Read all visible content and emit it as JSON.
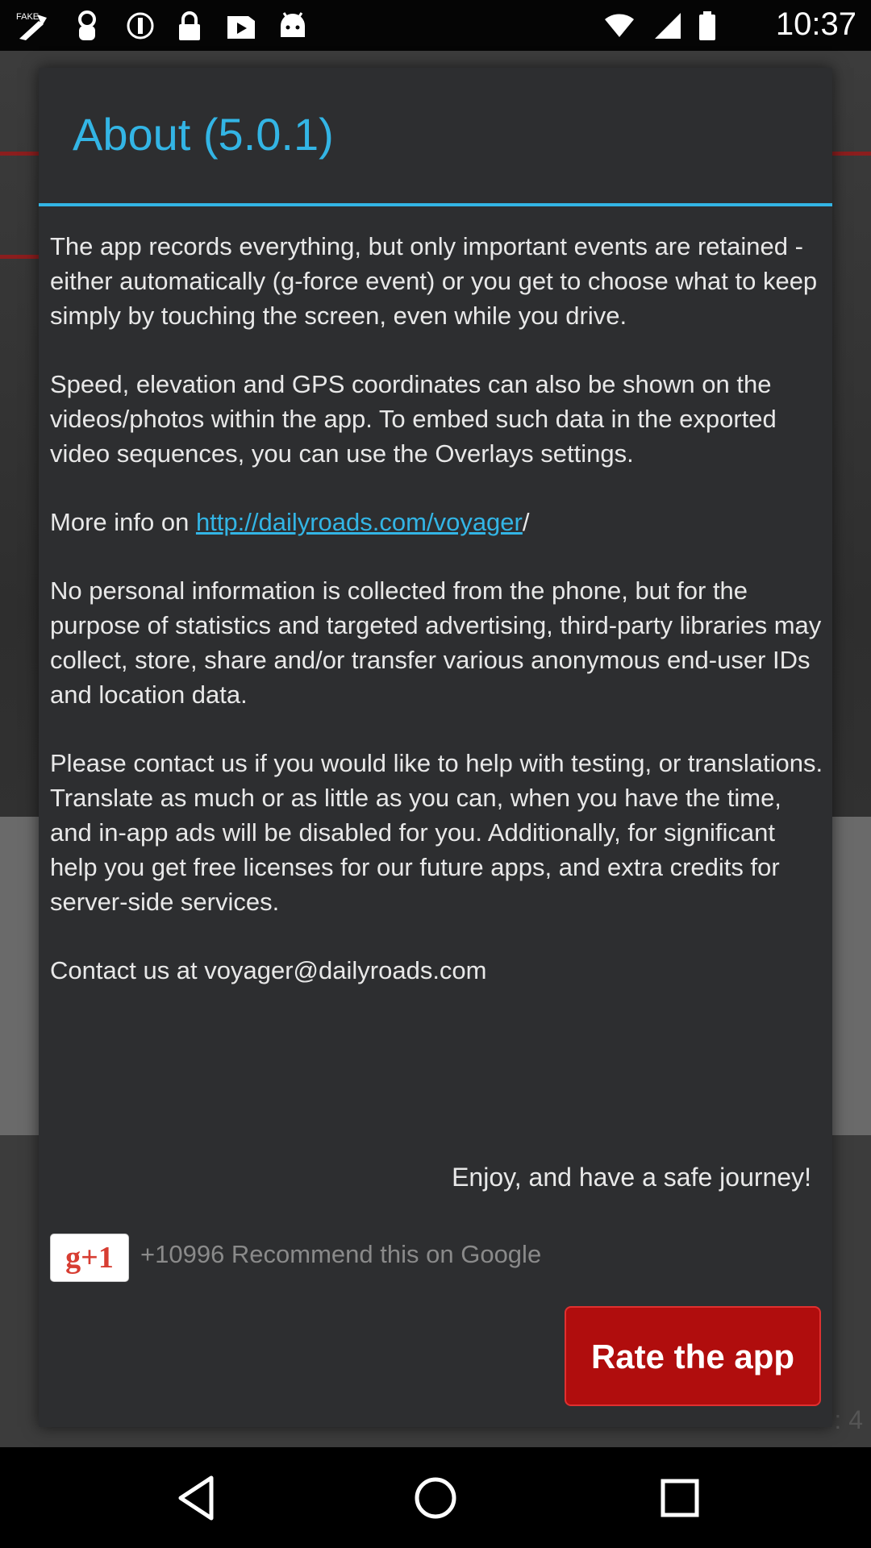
{
  "status_bar": {
    "time": "10:37",
    "icons": [
      "fake-gps-icon",
      "tv-remote-icon",
      "location-icon",
      "lock-icon",
      "youtube-icon",
      "android-icon",
      "wifi-icon",
      "signal-icon",
      "battery-icon"
    ]
  },
  "dialog": {
    "title": "About (5.0.1)",
    "paragraphs": {
      "p1": "The app records everything, but only important events are retained - either automatically (g-force event) or you get to choose what to keep simply by touching the screen, even while you drive.",
      "p2": "Speed, elevation and GPS coordinates can also be shown on the videos/photos within the app. To embed such data in the exported video sequences, you can use the Overlays settings.",
      "p3_prefix": "More info on ",
      "p3_link": "http://dailyroads.com/voyager",
      "p3_suffix": "/",
      "p4": "No personal information is collected from the phone, but for the purpose of statistics and targeted advertising, third-party libraries may collect, store, share and/or transfer various anonymous end-user IDs and location data.",
      "p5": "Please contact us if you would like to help with testing, or translations. Translate as much or as little as you can, when you have the time, and in-app ads will be disabled for you. Additionally, for significant help you get free licenses for our future apps, and extra credits for server-side services.",
      "p6": "Contact us at voyager@dailyroads.com"
    },
    "enjoy": "Enjoy, and have a safe journey!",
    "gplus_label": "g+1",
    "gplus_count": "+10996 Recommend this on Google",
    "rate_button": "Rate the app"
  },
  "background": {
    "partial_text": ": 4"
  },
  "colors": {
    "accent": "#33b5e5",
    "dialog_bg": "#2d2e30",
    "rate_button_bg": "#b00d0d",
    "gplus_red": "#d73d32"
  },
  "nav_bar": {
    "buttons": [
      "back-icon",
      "home-icon",
      "recents-icon"
    ]
  }
}
